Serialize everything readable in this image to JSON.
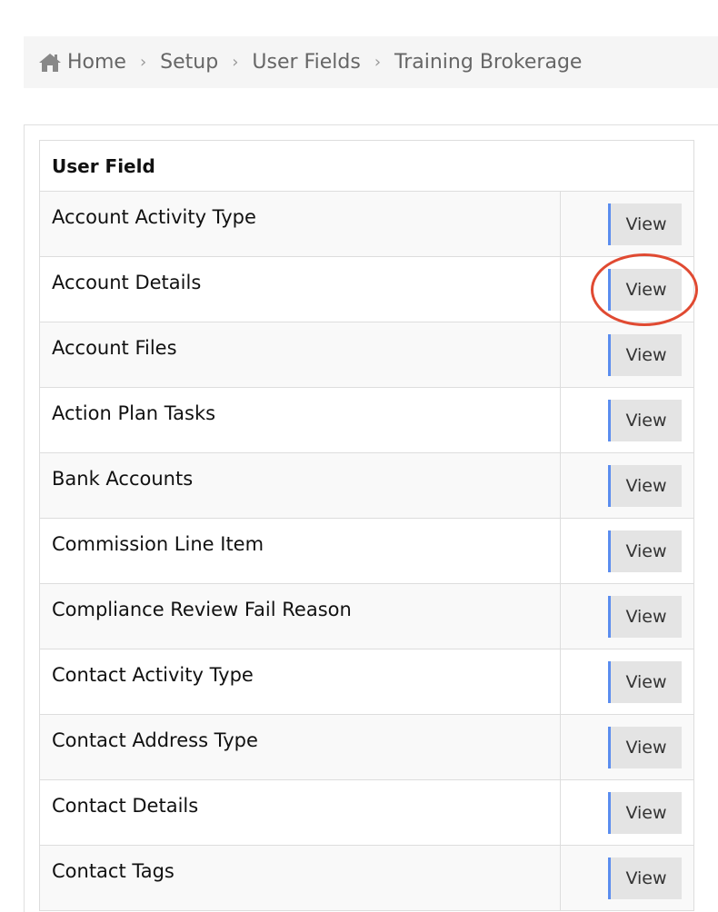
{
  "breadcrumb": {
    "items": [
      "Home",
      "Setup",
      "User Fields",
      "Training Brokerage"
    ],
    "separator": "›",
    "home_icon": "home-icon"
  },
  "table": {
    "header": "User Field",
    "button_label": "View",
    "rows": [
      {
        "name": "Account Activity Type"
      },
      {
        "name": "Account Details"
      },
      {
        "name": "Account Files"
      },
      {
        "name": "Action Plan Tasks"
      },
      {
        "name": "Bank Accounts"
      },
      {
        "name": "Commission Line Item"
      },
      {
        "name": "Compliance Review Fail Reason"
      },
      {
        "name": "Contact Activity Type"
      },
      {
        "name": "Contact Address Type"
      },
      {
        "name": "Contact Details"
      },
      {
        "name": "Contact Tags"
      }
    ]
  },
  "colors": {
    "accent": "#5b8def",
    "highlight": "#e04a32"
  }
}
